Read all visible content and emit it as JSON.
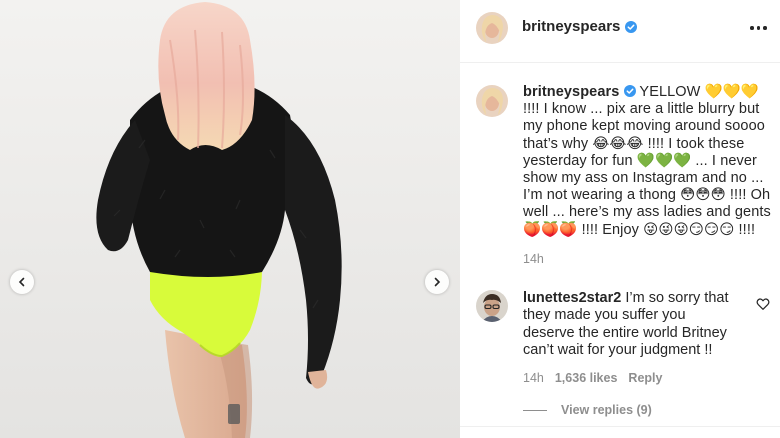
{
  "post": {
    "username": "britneyspears",
    "verified": true
  },
  "caption": {
    "username": "britneyspears",
    "text": "YELLOW 💛💛💛 !!!! I know ... pix are a little blurry but my phone kept moving around soooo that’s why 😂😂😂 !!!! I took these yesterday for fun 💚💚💚 ... I never show my ass on Instagram and no ... I’m not wearing a thong 😳😳😳 !!!! Oh well ... here’s my ass ladies and gents 🍑🍑🍑 !!!! Enjoy 😜😜😜😏😏😏 !!!!",
    "time": "14h"
  },
  "comment": {
    "username": "lunettes2star2",
    "text": "I’m so sorry that they made you suffer you deserve the entire world Britney can’t wait for your judgment !!",
    "time": "14h",
    "likes": "1,636 likes",
    "reply_label": "Reply",
    "view_replies": "View replies (9)"
  },
  "icons": {
    "more": "more-options-icon",
    "verified": "verified-badge-icon",
    "heart": "heart-outline-icon",
    "prev": "chevron-left-icon",
    "next": "chevron-right-icon"
  },
  "colors": {
    "verified_blue": "#3897f0",
    "muted_text": "#8e8e8e",
    "text": "#262626",
    "bodysuit": "#d8fb3a",
    "jacket": "#151515",
    "hair": "#f0c4b4"
  }
}
